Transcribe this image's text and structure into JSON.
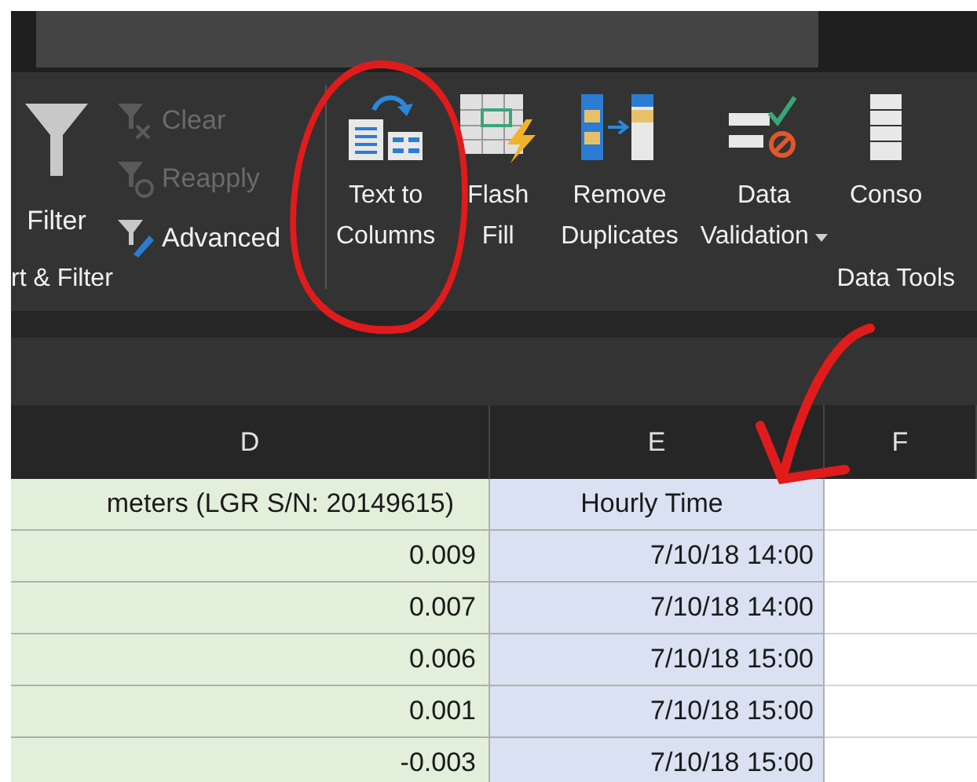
{
  "sort_filter_group": {
    "label": "rt & Filter",
    "buttons": [
      {
        "lines": [
          "Filter"
        ],
        "kind": "big",
        "disabled": false
      },
      {
        "lines": [
          "Clear"
        ],
        "kind": "small",
        "disabled": true
      },
      {
        "lines": [
          "Reapply"
        ],
        "kind": "small",
        "disabled": true
      },
      {
        "lines": [
          "Advanced"
        ],
        "kind": "small",
        "disabled": false
      }
    ]
  },
  "data_tools_group": {
    "label": "Data Tools",
    "buttons": [
      {
        "lines": [
          "Text to",
          "Columns"
        ],
        "dropdown": false
      },
      {
        "lines": [
          "Flash",
          "Fill"
        ],
        "dropdown": false
      },
      {
        "lines": [
          "Remove",
          "Duplicates"
        ],
        "dropdown": false
      },
      {
        "lines": [
          "Data",
          "Validation"
        ],
        "dropdown": true
      },
      {
        "lines": [
          "Conso"
        ],
        "dropdown": false
      }
    ]
  },
  "columns": [
    "D",
    "E",
    "F"
  ],
  "rows": [
    {
      "kind": "header",
      "d": "meters (LGR S/N: 20149615)",
      "e": "Hourly Time"
    },
    {
      "kind": "data",
      "d": "0.009",
      "e": "7/10/18 14:00"
    },
    {
      "kind": "data",
      "d": "0.007",
      "e": "7/10/18 14:00"
    },
    {
      "kind": "data",
      "d": "0.006",
      "e": "7/10/18 15:00"
    },
    {
      "kind": "data",
      "d": "0.001",
      "e": "7/10/18 15:00"
    },
    {
      "kind": "data",
      "d": "-0.003",
      "e": "7/10/18 15:00"
    }
  ]
}
